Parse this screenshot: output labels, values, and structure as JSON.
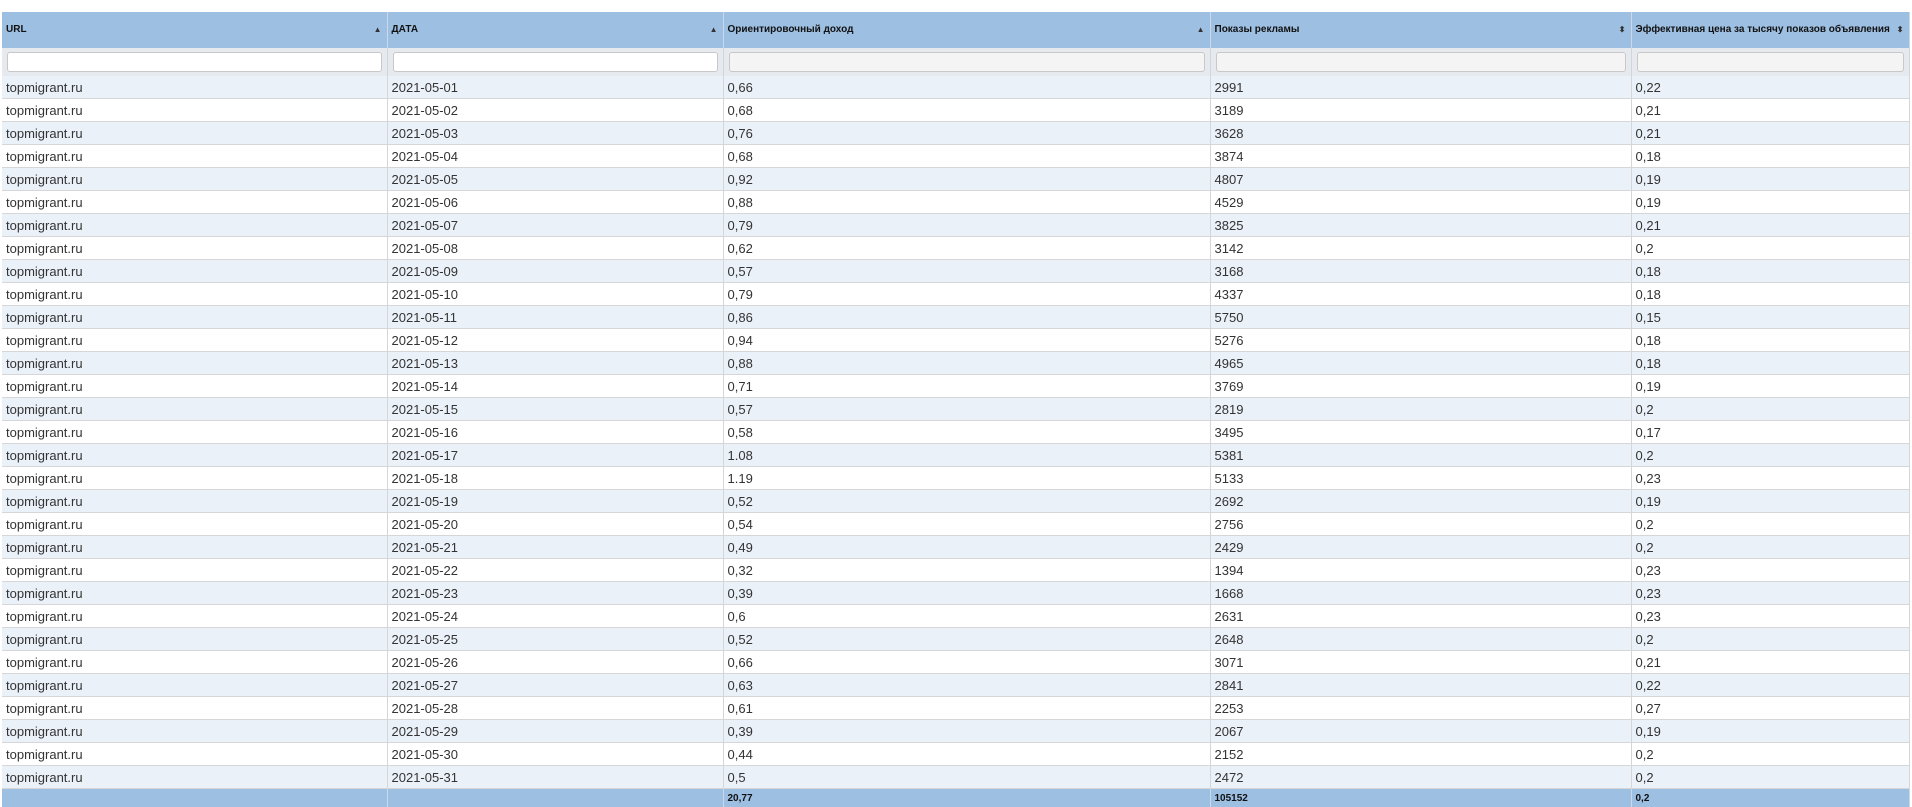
{
  "columns": [
    {
      "label": "URL",
      "sort": "▲"
    },
    {
      "label": "ДАТА",
      "sort": "▲"
    },
    {
      "label": "Ориентировочный доход",
      "sort": "▲"
    },
    {
      "label": "Показы рекламы",
      "sort": "⬍"
    },
    {
      "label": "Эффективная цена за тысячу показов объявления",
      "sort": "⬍"
    }
  ],
  "rows": [
    [
      "topmigrant.ru",
      "2021-05-01",
      "0,66",
      "2991",
      "0,22"
    ],
    [
      "topmigrant.ru",
      "2021-05-02",
      "0,68",
      "3189",
      "0,21"
    ],
    [
      "topmigrant.ru",
      "2021-05-03",
      "0,76",
      "3628",
      "0,21"
    ],
    [
      "topmigrant.ru",
      "2021-05-04",
      "0,68",
      "3874",
      "0,18"
    ],
    [
      "topmigrant.ru",
      "2021-05-05",
      "0,92",
      "4807",
      "0,19"
    ],
    [
      "topmigrant.ru",
      "2021-05-06",
      "0,88",
      "4529",
      "0,19"
    ],
    [
      "topmigrant.ru",
      "2021-05-07",
      "0,79",
      "3825",
      "0,21"
    ],
    [
      "topmigrant.ru",
      "2021-05-08",
      "0,62",
      "3142",
      "0,2"
    ],
    [
      "topmigrant.ru",
      "2021-05-09",
      "0,57",
      "3168",
      "0,18"
    ],
    [
      "topmigrant.ru",
      "2021-05-10",
      "0,79",
      "4337",
      "0,18"
    ],
    [
      "topmigrant.ru",
      "2021-05-11",
      "0,86",
      "5750",
      "0,15"
    ],
    [
      "topmigrant.ru",
      "2021-05-12",
      "0,94",
      "5276",
      "0,18"
    ],
    [
      "topmigrant.ru",
      "2021-05-13",
      "0,88",
      "4965",
      "0,18"
    ],
    [
      "topmigrant.ru",
      "2021-05-14",
      "0,71",
      "3769",
      "0,19"
    ],
    [
      "topmigrant.ru",
      "2021-05-15",
      "0,57",
      "2819",
      "0,2"
    ],
    [
      "topmigrant.ru",
      "2021-05-16",
      "0,58",
      "3495",
      "0,17"
    ],
    [
      "topmigrant.ru",
      "2021-05-17",
      "1.08",
      "5381",
      "0,2"
    ],
    [
      "topmigrant.ru",
      "2021-05-18",
      "1.19",
      "5133",
      "0,23"
    ],
    [
      "topmigrant.ru",
      "2021-05-19",
      "0,52",
      "2692",
      "0,19"
    ],
    [
      "topmigrant.ru",
      "2021-05-20",
      "0,54",
      "2756",
      "0,2"
    ],
    [
      "topmigrant.ru",
      "2021-05-21",
      "0,49",
      "2429",
      "0,2"
    ],
    [
      "topmigrant.ru",
      "2021-05-22",
      "0,32",
      "1394",
      "0,23"
    ],
    [
      "topmigrant.ru",
      "2021-05-23",
      "0,39",
      "1668",
      "0,23"
    ],
    [
      "topmigrant.ru",
      "2021-05-24",
      "0,6",
      "2631",
      "0,23"
    ],
    [
      "topmigrant.ru",
      "2021-05-25",
      "0,52",
      "2648",
      "0,2"
    ],
    [
      "topmigrant.ru",
      "2021-05-26",
      "0,66",
      "3071",
      "0,21"
    ],
    [
      "topmigrant.ru",
      "2021-05-27",
      "0,63",
      "2841",
      "0,22"
    ],
    [
      "topmigrant.ru",
      "2021-05-28",
      "0,61",
      "2253",
      "0,27"
    ],
    [
      "topmigrant.ru",
      "2021-05-29",
      "0,39",
      "2067",
      "0,19"
    ],
    [
      "topmigrant.ru",
      "2021-05-30",
      "0,44",
      "2152",
      "0,2"
    ],
    [
      "topmigrant.ru",
      "2021-05-31",
      "0,5",
      "2472",
      "0,2"
    ]
  ],
  "totals": [
    "",
    "",
    "20,77",
    "105152",
    "0,2"
  ]
}
